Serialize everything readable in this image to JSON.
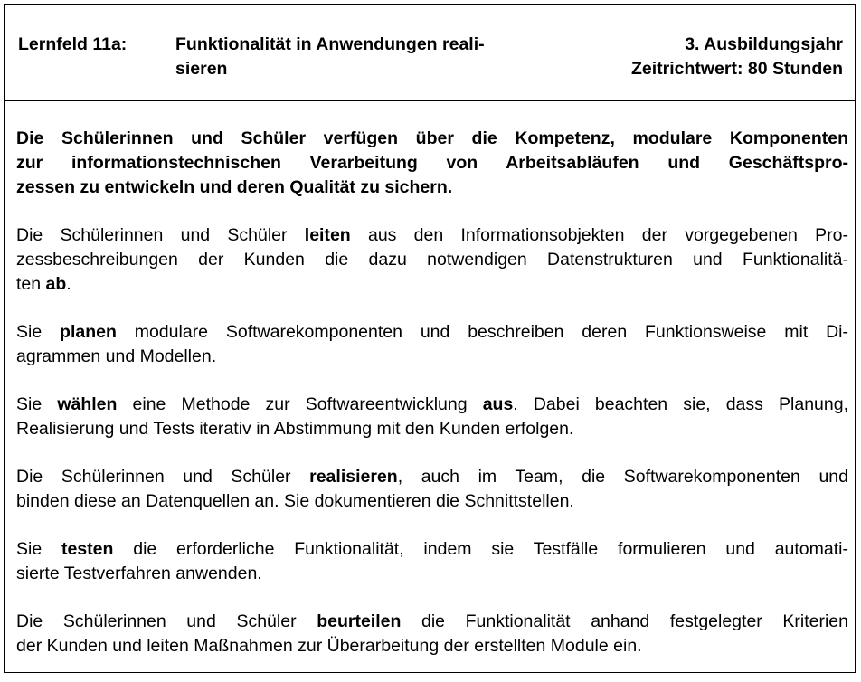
{
  "header": {
    "field_label": "Lernfeld 11a:",
    "title_lines": [
      "Funktionalität in Anwendungen reali-",
      "sieren"
    ],
    "year": "3. Ausbildungsjahr",
    "time": "Zeitrichtwert: 80 Stunden"
  },
  "paragraphs": [
    {
      "bold": true,
      "lines": [
        [
          {
            "t": "Die Schülerinnen und Schüler verfügen über die Kompetenz, modulare Komponenten"
          }
        ],
        [
          {
            "t": "zur informationstechnischen Verarbeitung von Arbeitsabläufen und Geschäftspro-"
          }
        ],
        [
          {
            "t": "zessen zu entwickeln und deren Qualität zu sichern."
          }
        ]
      ]
    },
    {
      "bold": false,
      "lines": [
        [
          {
            "t": "Die Schülerinnen und Schüler "
          },
          {
            "t": "leiten",
            "b": true
          },
          {
            "t": " aus den Informationsobjekten der vorgegebenen Pro-"
          }
        ],
        [
          {
            "t": "zessbeschreibungen der Kunden die dazu notwendigen Datenstrukturen und Funktionalitä-"
          }
        ],
        [
          {
            "t": "ten "
          },
          {
            "t": "ab",
            "b": true
          },
          {
            "t": "."
          }
        ]
      ]
    },
    {
      "bold": false,
      "lines": [
        [
          {
            "t": "Sie "
          },
          {
            "t": "planen",
            "b": true
          },
          {
            "t": " modulare Softwarekomponenten und beschreiben deren Funktionsweise mit Di-"
          }
        ],
        [
          {
            "t": "agrammen und Modellen."
          }
        ]
      ]
    },
    {
      "bold": false,
      "lines": [
        [
          {
            "t": "Sie "
          },
          {
            "t": "wählen",
            "b": true
          },
          {
            "t": " eine Methode zur Softwareentwicklung "
          },
          {
            "t": "aus",
            "b": true
          },
          {
            "t": ". Dabei beachten sie, dass Planung,"
          }
        ],
        [
          {
            "t": "Realisierung und Tests iterativ in Abstimmung mit den Kunden erfolgen."
          }
        ]
      ]
    },
    {
      "bold": false,
      "lines": [
        [
          {
            "t": "Die Schülerinnen und Schüler "
          },
          {
            "t": "realisieren",
            "b": true
          },
          {
            "t": ", auch im Team, die Softwarekomponenten und"
          }
        ],
        [
          {
            "t": "binden diese an Datenquellen an. Sie dokumentieren die Schnittstellen."
          }
        ]
      ]
    },
    {
      "bold": false,
      "lines": [
        [
          {
            "t": "Sie "
          },
          {
            "t": "testen",
            "b": true
          },
          {
            "t": " die erforderliche Funktionalität, indem sie Testfälle formulieren und automati-"
          }
        ],
        [
          {
            "t": "sierte Testverfahren anwenden."
          }
        ]
      ]
    },
    {
      "bold": false,
      "lines": [
        [
          {
            "t": "Die Schülerinnen und Schüler "
          },
          {
            "t": "beurteilen",
            "b": true
          },
          {
            "t": " die Funktionalität anhand festgelegter Kriterien"
          }
        ],
        [
          {
            "t": "der Kunden und leiten Maßnahmen zur Überarbeitung der erstellten Module ein."
          }
        ]
      ]
    }
  ]
}
